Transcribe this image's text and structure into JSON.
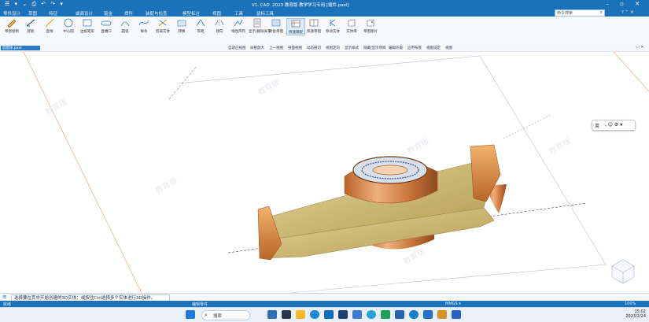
{
  "window": {
    "title": "V1. CAD. 2023 教育版  教学学习专用  [插件.paxl]",
    "quick_access": "☰ ▾ ⌄ ⎙ ↶ ↷ ▾",
    "controls": "–  ▫  ✕"
  },
  "menubar": {
    "items": [
      "零件设计",
      "草图",
      "特征",
      "曲面设计",
      "钣金",
      "焊件",
      "装配与检查",
      "模型标注",
      "视图",
      "工具",
      "鼠标工具"
    ],
    "search_placeholder": "命令搜索",
    "search_icon": "⌕",
    "right_icons": "? ⌃ ✕"
  },
  "ribbon": {
    "buttons": [
      {
        "label": "草图绘制",
        "icon": "pencil-icon"
      },
      {
        "label": "智能",
        "icon": "dimension-icon"
      },
      {
        "label": "直线",
        "icon": "line-icon"
      },
      {
        "label": "中心圆",
        "icon": "circle-icon"
      },
      {
        "label": "边角矩形",
        "icon": "rect-icon"
      },
      {
        "label": "直槽口",
        "icon": "slot-icon"
      },
      {
        "label": "圆弧",
        "icon": "arc-icon"
      },
      {
        "label": "样条",
        "icon": "spline-icon"
      },
      {
        "label": "剪裁实体",
        "icon": "trim-icon"
      },
      {
        "label": "转换",
        "icon": "convert-icon"
      },
      {
        "label": "等距",
        "icon": "offset-icon"
      },
      {
        "label": "镜向",
        "icon": "mirror-icon"
      },
      {
        "label": "线性阵列",
        "icon": "pattern-icon"
      },
      {
        "label": "显示/删除关系",
        "icon": "relation-icon"
      },
      {
        "label": "修复草图",
        "icon": "repair-icon"
      },
      {
        "label": "快速捕捉",
        "icon": "snap-icon"
      },
      {
        "label": "快速草图",
        "icon": "quick-sketch-icon"
      },
      {
        "label": "移动实体",
        "icon": "move-icon"
      },
      {
        "label": "实体库",
        "icon": "library-icon"
      },
      {
        "label": "草图图片",
        "icon": "image-icon"
      }
    ],
    "active_index": 15
  },
  "viewbar": {
    "doc_tab": "装配体.paxl",
    "items": [
      "自适应视图",
      "局部放大",
      "上一视图",
      "剖面视图",
      "动态剖切",
      "视图定向",
      "显示样式",
      "隐藏/显示项目",
      "编辑外观",
      "应用布景",
      "视图设定",
      "视图"
    ],
    "right": "‹ › ✕"
  },
  "canvas": {
    "watermark": "教育版",
    "ime_text": "英",
    "ime_icons": "·, ☺ ⚙ ▾"
  },
  "command": {
    "prompt_icon": "≡",
    "message": "选择要在其中开始创建的3D实体：或按住Ctrl选择多个实体进行3D操作。"
  },
  "status": {
    "left": "就绪",
    "center": "编辑零件",
    "right": "MMGS  ▾",
    "zoom": "100%"
  },
  "taskbar": {
    "search_placeholder": "搜索",
    "search_icon": "⌕",
    "time": "15:02",
    "date": "2023/2/24"
  },
  "colors": {
    "accent": "#1c72b8",
    "copper": "#c9743a",
    "plate": "#d8c07a"
  }
}
